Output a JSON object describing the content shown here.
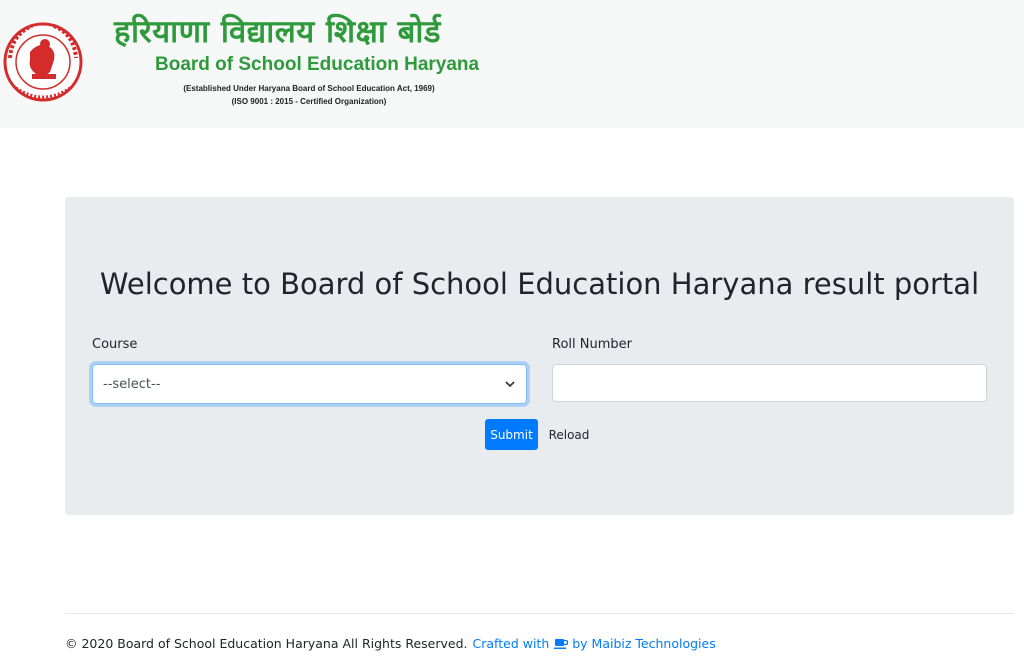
{
  "header": {
    "hindi_title": "हरियाणा विद्यालय शिक्षा बोर्ड",
    "english_title": "Board of School Education Haryana",
    "established_line": "(Established Under Haryana Board of School Education Act, 1969)",
    "iso_line": "(ISO 9001 : 2015 - Certified Organization)",
    "logo_icon": "emblem-icon",
    "brand_color": "#2e9a3c",
    "logo_color": "#d42b2b"
  },
  "main": {
    "welcome": "Welcome to Board of School Education Haryana result portal",
    "course_label": "Course",
    "course_selected": "--select--",
    "roll_label": "Roll Number",
    "roll_value": "",
    "submit_label": "Submit",
    "reload_label": "Reload",
    "accent_color": "#007bff"
  },
  "footer": {
    "copyright": "© 2020 Board of School Education Haryana All Rights Reserved.",
    "crafted_prefix": "Crafted with",
    "crafted_suffix": "by Maibiz Technologies",
    "icon": "coffee-icon"
  }
}
